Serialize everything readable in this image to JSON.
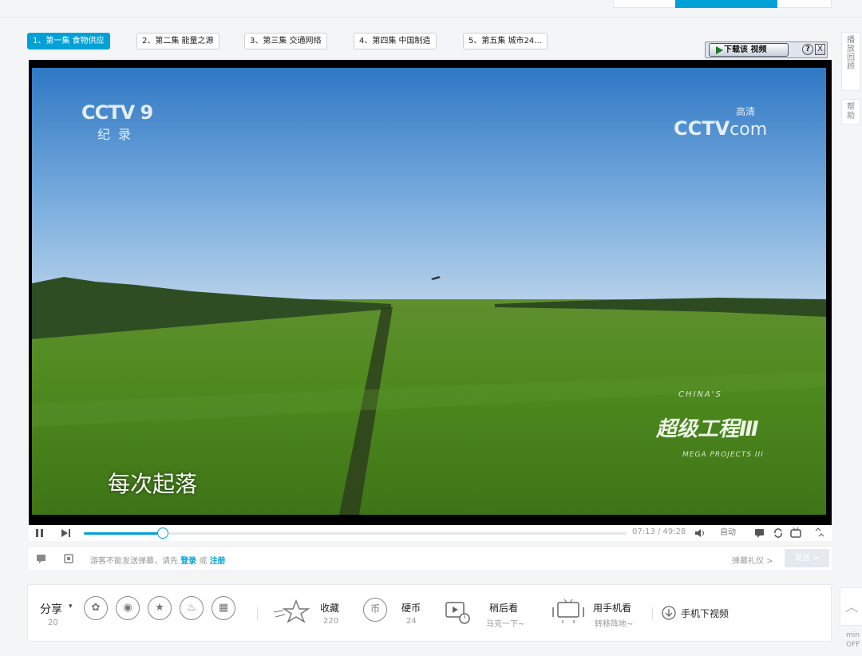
{
  "parts": [
    {
      "label": "1、第一集 食物供应",
      "active": true
    },
    {
      "label": "2、第二集 能量之源",
      "active": false
    },
    {
      "label": "3、第三集 交通网络",
      "active": false
    },
    {
      "label": "4、第四集 中国制造",
      "active": false
    },
    {
      "label": "5、第五集 城市24...",
      "active": false
    }
  ],
  "download_widget": {
    "label": "下载该 视频",
    "help": "?",
    "close": "X"
  },
  "side_tabs": {
    "replay": "播放回顾",
    "help": "帮助"
  },
  "video": {
    "channel_logo": "CCTV 9",
    "channel_sub": "纪录",
    "site_logo": "CCTV",
    "site_logo_suffix": "com",
    "site_logo_hd": "高清",
    "subtitle": "每次起落",
    "show_title": "超级工程Ⅲ",
    "show_en_top": "CHINA'S",
    "show_en_bottom": "MEGA PROJECTS III"
  },
  "player": {
    "current_time": "07:13",
    "duration": "49:28",
    "time_display": "07:13 / 49:28",
    "progress": 0.146,
    "quality": "自动",
    "pause_icon": "pause-icon",
    "next_icon": "next-icon"
  },
  "danmaku": {
    "hint": "游客不能发送弹幕，请先",
    "login": "登录",
    "or": "或",
    "register": "注册",
    "etiquette": "弹幕礼仪 >",
    "send": "发送 >"
  },
  "actions": {
    "share_label": "分享",
    "share_count": "20",
    "favorite_label": "收藏",
    "favorite_count": "220",
    "coin_label": "硬币",
    "coin_count": "24",
    "watch_later_label": "稍后看",
    "watch_later_sub": "马克一下~",
    "mobile_label": "用手机看",
    "mobile_sub": "转移阵地~",
    "download_label": "手机下视频"
  },
  "mini": {
    "line1": "min",
    "line2": "OFF"
  },
  "colors": {
    "accent": "#00a1d6",
    "annotation_arrow": "#e02020"
  }
}
